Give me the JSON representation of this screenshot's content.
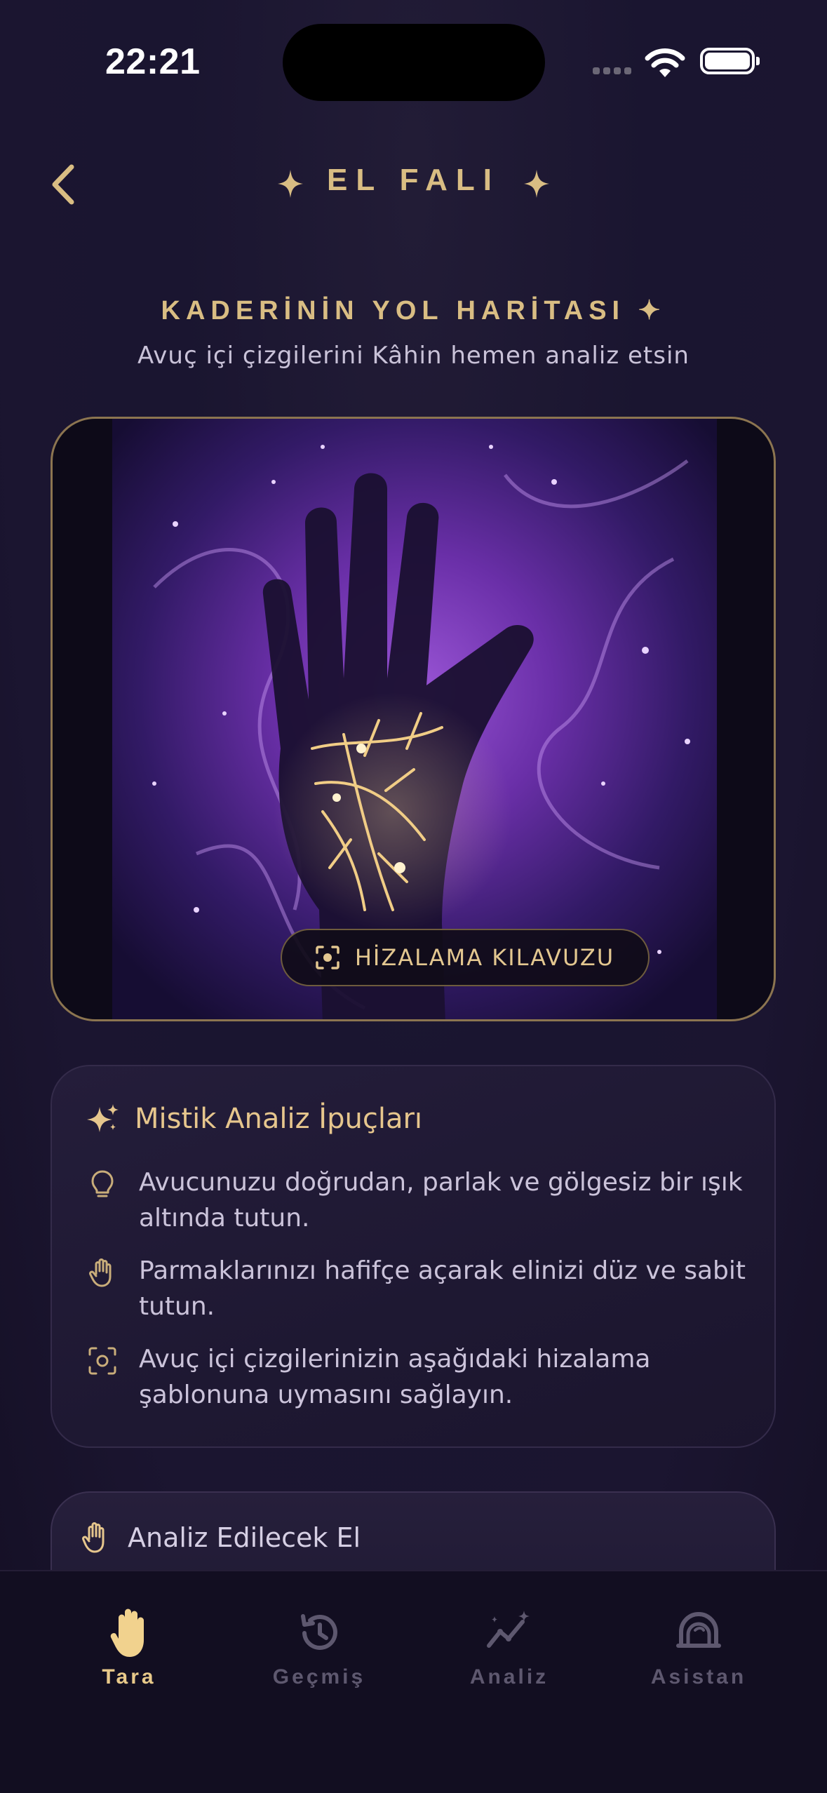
{
  "status_bar": {
    "time": "22:21"
  },
  "header": {
    "title": "EL FALI",
    "back_icon": "chevron-left-icon",
    "star_icon": "four-point-star-icon"
  },
  "intro": {
    "heading": "KADERİNİN YOL HARİTASI ✦",
    "subtitle": "Avuç içi çizgilerini Kâhin hemen analiz etsin"
  },
  "scan_preview": {
    "guide_button_label": "HİZALAMA KILAVUZU",
    "guide_icon": "scan-focus-icon"
  },
  "tips": {
    "title": "Mistik Analiz İpuçları",
    "title_icon": "sparkles-icon",
    "items": [
      {
        "icon": "lightbulb-icon",
        "text": "Avucunuzu doğrudan, parlak ve gölgesiz bir ışık altında tutun."
      },
      {
        "icon": "hand-icon",
        "text": "Parmaklarınızı hafifçe açarak elinizi düz ve sabit tutun."
      },
      {
        "icon": "scan-focus-icon",
        "text": "Avuç içi çizgilerinizin aşağıdaki hizalama şablonuna uymasını sağlayın."
      }
    ]
  },
  "hand_selector": {
    "label": "Analiz Edilecek El",
    "icon": "hand-icon"
  },
  "tab_bar": {
    "tabs": [
      {
        "label": "Tara",
        "icon": "hand-icon",
        "active": true
      },
      {
        "label": "Geçmiş",
        "icon": "history-icon",
        "active": false
      },
      {
        "label": "Analiz",
        "icon": "analytics-icon",
        "active": false
      },
      {
        "label": "Asistan",
        "icon": "assistant-icon",
        "active": false
      }
    ]
  },
  "colors": {
    "accent_gold": "#d9bd83",
    "background": "#1a1530",
    "inactive_tab": "#5e586f"
  }
}
